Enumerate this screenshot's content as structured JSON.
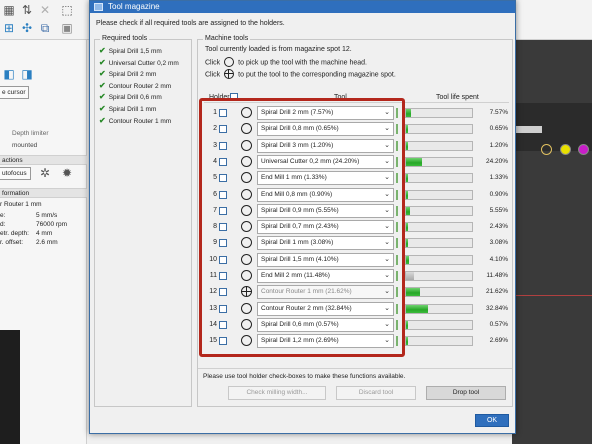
{
  "dialog": {
    "title": "Tool magazine",
    "instruction": "Please check if all required tools are assigned to the holders.",
    "required_tools_title": "Required tools",
    "required_tools": [
      "Spiral Drill   1,5 mm",
      "Universal Cutter 0,2 mm",
      "Spiral Drill   2 mm",
      "Contour Router 2 mm",
      "Spiral Drill   0,6 mm",
      "Spiral Drill   1 mm",
      "Contour Router 1 mm"
    ],
    "machine_tools_title": "Machine tools",
    "current_tool_text": "Tool currently loaded is from magazine spot 12.",
    "click_label_1": "Click",
    "pickup_text": "to pick up the tool with the machine head.",
    "click_label_2": "Click",
    "putback_text": "to put the tool to the corresponding magazine spot.",
    "col_holder": "Holder",
    "col_tool": "Tool",
    "col_life": "Tool life spent",
    "rows": [
      {
        "num": "1",
        "tool": "Spiral Drill   2 mm (7.57%)",
        "life": "7.57%",
        "life_value": 0.0757,
        "loaded": false
      },
      {
        "num": "2",
        "tool": "Spiral Drill   0,8 mm (0.65%)",
        "life": "0.65%",
        "life_value": 0.0065,
        "loaded": false
      },
      {
        "num": "3",
        "tool": "Spiral Drill   3 mm (1.20%)",
        "life": "1.20%",
        "life_value": 0.012,
        "loaded": false
      },
      {
        "num": "4",
        "tool": "Universal Cutter 0,2 mm (24.20%)",
        "life": "24.20%",
        "life_value": 0.242,
        "loaded": false
      },
      {
        "num": "5",
        "tool": "End Mill 1 mm (1.33%)",
        "life": "1.33%",
        "life_value": 0.0133,
        "loaded": false
      },
      {
        "num": "6",
        "tool": "End Mill 0,8 mm (0.90%)",
        "life": "0.90%",
        "life_value": 0.009,
        "loaded": false
      },
      {
        "num": "7",
        "tool": "Spiral Drill   0,9 mm (5.55%)",
        "life": "5.55%",
        "life_value": 0.0555,
        "loaded": false
      },
      {
        "num": "8",
        "tool": "Spiral Drill   0,7 mm (2.43%)",
        "life": "2.43%",
        "life_value": 0.0243,
        "loaded": false
      },
      {
        "num": "9",
        "tool": "Spiral Drill   1 mm (3.08%)",
        "life": "3.08%",
        "life_value": 0.0308,
        "loaded": false
      },
      {
        "num": "10",
        "tool": "Spiral Drill   1,5 mm (4.10%)",
        "life": "4.10%",
        "life_value": 0.041,
        "loaded": false
      },
      {
        "num": "11",
        "tool": "End Mill 2 mm (11.48%)",
        "life": "11.48%",
        "life_value": 0.1148,
        "loaded": false,
        "grey": true
      },
      {
        "num": "12",
        "tool": "Contour Router 1 mm (21.62%)",
        "life": "21.62%",
        "life_value": 0.2162,
        "loaded": true
      },
      {
        "num": "13",
        "tool": "Contour Router 2 mm (32.84%)",
        "life": "32.84%",
        "life_value": 0.3284,
        "loaded": false
      },
      {
        "num": "14",
        "tool": "Spiral Drill   0,6 mm (0.57%)",
        "life": "0.57%",
        "life_value": 0.0057,
        "loaded": false
      },
      {
        "num": "15",
        "tool": "Spiral Drill   1,2 mm (2.69%)",
        "life": "2.69%",
        "life_value": 0.0269,
        "loaded": false
      }
    ],
    "note": "Please use tool holder check-boxes to make these functions available.",
    "check_milling_width": "Check milling width...",
    "discard_tool": "Discard tool",
    "drop_tool": "Drop tool",
    "ok": "OK"
  },
  "background": {
    "cursor_button": "e cursor",
    "depth_limiter": "Depth limiter",
    "mounted": "mounted",
    "functions_header": "actions",
    "autofocus": "utofocus",
    "information_header": "formation",
    "tool_name": "r Router 1 mm",
    "labels": [
      "e:",
      "d:",
      "etr. depth:",
      "r. offset:"
    ],
    "values": [
      "5 mm/s",
      "76000 rpm",
      "4 mm",
      "2.6 mm"
    ]
  },
  "colors": {
    "accent": "#2f6fbd",
    "highlight_frame": "#b3271c",
    "life_bar_green": "#27a727",
    "check_green": "#2a8a2a"
  },
  "icons": {
    "pickup": "circle-icon",
    "putback": "crosshair-circle-icon",
    "required_check": "checkmark-icon"
  }
}
